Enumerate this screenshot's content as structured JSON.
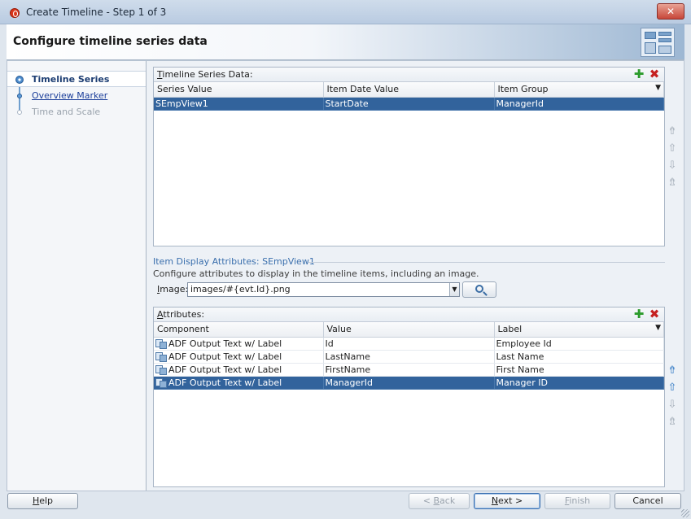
{
  "window": {
    "title": "Create Timeline - Step 1 of 3",
    "close_label": "✕"
  },
  "header": {
    "title": "Configure timeline series data"
  },
  "nav": {
    "items": [
      {
        "label": "Timeline Series",
        "state": "active"
      },
      {
        "label": "Overview Marker",
        "state": "link"
      },
      {
        "label": "Time and Scale",
        "state": "disabled"
      }
    ]
  },
  "series_panel": {
    "title_prefix": "T",
    "title_rest": "imeline Series Data:",
    "columns": [
      "Series Value",
      "Item Date Value",
      "Item Group"
    ],
    "rows": [
      {
        "cells": [
          "SEmpView1",
          "StartDate",
          "ManagerId"
        ],
        "selected": true
      }
    ]
  },
  "display": {
    "section_label": "Item Display Attributes: SEmpView1",
    "description": "Configure attributes to display in the timeline items, including an image.",
    "image_label_prefix": "I",
    "image_label_rest": "mage:",
    "image_value": "images/#{evt.Id}.png"
  },
  "attributes_panel": {
    "title_prefix": "A",
    "title_rest": "ttributes:",
    "columns": [
      "Component",
      "Value",
      "Label"
    ],
    "rows": [
      {
        "cells": [
          "ADF Output Text w/ Label",
          "Id",
          "Employee Id"
        ],
        "selected": false
      },
      {
        "cells": [
          "ADF Output Text w/ Label",
          "LastName",
          "Last Name"
        ],
        "selected": false
      },
      {
        "cells": [
          "ADF Output Text w/ Label",
          "FirstName",
          "First Name"
        ],
        "selected": false
      },
      {
        "cells": [
          "ADF Output Text w/ Label",
          "ManagerId",
          "Manager ID"
        ],
        "selected": true
      }
    ]
  },
  "footer": {
    "help": {
      "u": "H",
      "rest": "elp"
    },
    "back": {
      "pre": "< ",
      "u": "B",
      "rest": "ack"
    },
    "next": {
      "u": "N",
      "rest": "ext >"
    },
    "finish": {
      "u": "F",
      "rest": "inish"
    },
    "cancel": "Cancel"
  },
  "colors": {
    "selection": "#32639c",
    "add": "#2c9b2c",
    "delete": "#c52020",
    "link": "#1c3f9a"
  }
}
